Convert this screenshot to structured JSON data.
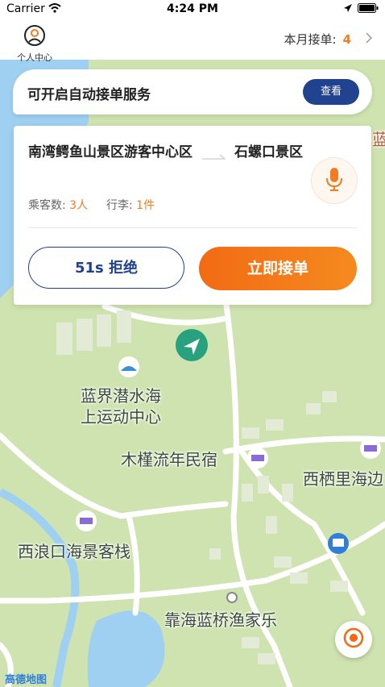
{
  "status_bar": {
    "carrier": "Carrier",
    "time": "4:24 PM"
  },
  "header": {
    "profile_label": "个人中心",
    "monthly_label": "本月接单:",
    "monthly_count": "4"
  },
  "auto_banner": {
    "text": "可开启自动接单服务",
    "button": "查看"
  },
  "order": {
    "from": "南湾鳄鱼山景区游客中心区",
    "to": "石螺口景区",
    "passengers_label": "乘客数:",
    "passengers_value": "3人",
    "luggage_label": "行李:",
    "luggage_value": "1件",
    "reject_label": "51s 拒绝",
    "accept_label": "立即接单"
  },
  "map": {
    "pois": [
      {
        "name": "蓝界潜水海上运动中心",
        "line1": "蓝界潜水海",
        "line2": "上运动中心"
      },
      {
        "name": "木槿流年民宿"
      },
      {
        "name": "西栖里海边"
      },
      {
        "name": "西浪口海景客栈"
      },
      {
        "name": "靠海蓝桥渔家乐"
      },
      {
        "name": "蓝"
      }
    ],
    "logo": "高德地图",
    "colors": {
      "land": "#cfe3b0",
      "water": "#9fd0f2",
      "road": "#ffffff",
      "accent": "#f47c20",
      "brand_blue": "#21438f"
    }
  }
}
